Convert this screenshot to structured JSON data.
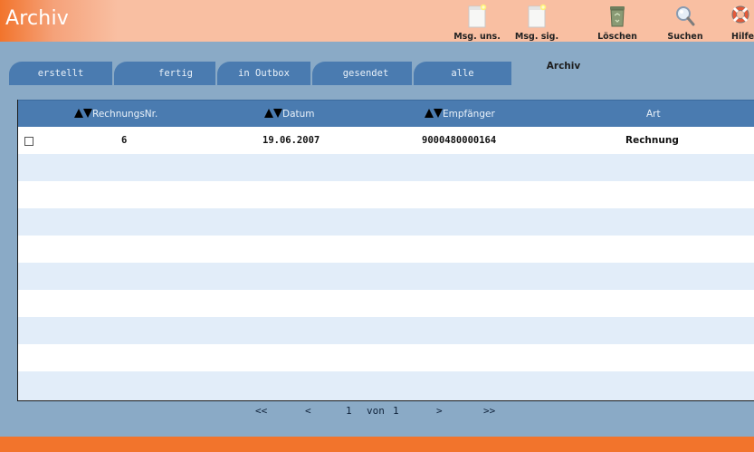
{
  "app": {
    "title": "Archiv"
  },
  "toolbar": [
    {
      "id": "msg-uns",
      "label": "Msg. uns.",
      "icon": "new-document-icon"
    },
    {
      "id": "msg-sig",
      "label": "Msg. sig.",
      "icon": "new-document-icon"
    },
    {
      "id": "loeschen",
      "label": "Löschen",
      "icon": "recycle-bin-icon"
    },
    {
      "id": "suchen",
      "label": "Suchen",
      "icon": "magnifier-icon"
    },
    {
      "id": "hilfe",
      "label": "Hilfe",
      "icon": "lifebuoy-icon"
    }
  ],
  "tabs": [
    {
      "label": "erstellt",
      "active": false
    },
    {
      "label": "fertig",
      "active": false
    },
    {
      "label": "in Outbox",
      "active": false
    },
    {
      "label": "gesendet",
      "active": false
    },
    {
      "label": "alle",
      "active": false
    },
    {
      "label": "Archiv",
      "active": true
    }
  ],
  "table": {
    "columns": [
      {
        "label": "RechnungsNr.",
        "sortable": true
      },
      {
        "label": "Datum",
        "sortable": true
      },
      {
        "label": "Empfänger",
        "sortable": true
      },
      {
        "label": "Art",
        "sortable": false
      }
    ],
    "rows": [
      {
        "checked": false,
        "nr": "6",
        "datum": "19.06.2007",
        "empfaenger": "9000480000164",
        "art": "Rechnung"
      }
    ],
    "empty_rows": 9
  },
  "pager": {
    "first": "<<",
    "prev": "<",
    "current": "1",
    "of_label": "von",
    "total": "1",
    "next": ">",
    "last": ">>"
  },
  "colors": {
    "brand_orange": "#f2742c",
    "header_peach": "#f9bfa2",
    "tab_blue": "#4a7bb0",
    "panel_blue": "#8aaac6",
    "row_alt": "#e2edf9"
  }
}
